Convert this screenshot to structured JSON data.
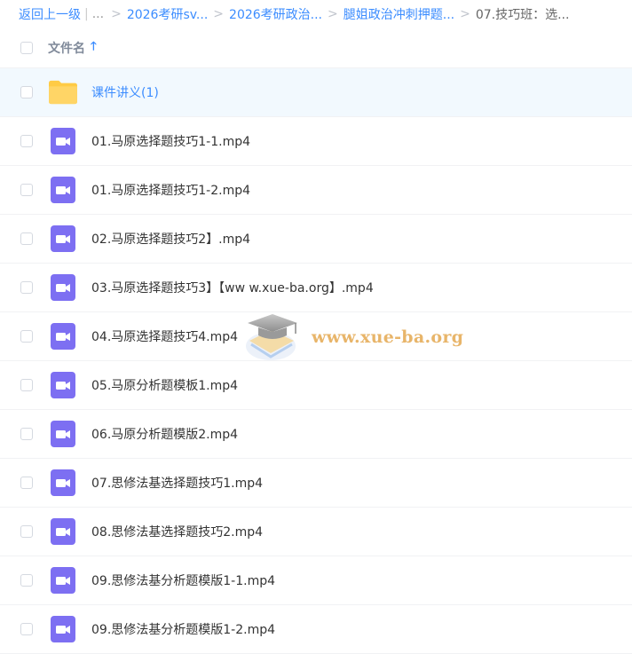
{
  "breadcrumb": {
    "back": "返回上一级",
    "dots": "...",
    "items": [
      "2026考研sv...",
      "2026考研政治...",
      "腿姐政治冲刺押题..."
    ],
    "current": "07.技巧班：选..."
  },
  "header": {
    "name_col": "文件名",
    "sort_icon": "arrow-up-icon"
  },
  "rows": [
    {
      "name": "课件讲义(1)",
      "type": "folder"
    },
    {
      "name": "01.马原选择题技巧1-1.mp4",
      "type": "video"
    },
    {
      "name": "01.马原选择题技巧1-2.mp4",
      "type": "video"
    },
    {
      "name": "02.马原选择题技巧2】.mp4",
      "type": "video"
    },
    {
      "name": "03.马原选择题技巧3】【ww w.xue-ba.org】.mp4",
      "type": "video"
    },
    {
      "name": "04.马原选择题技巧4.mp4",
      "type": "video"
    },
    {
      "name": "05.马原分析题模板1.mp4",
      "type": "video"
    },
    {
      "name": "06.马原分析题模版2.mp4",
      "type": "video"
    },
    {
      "name": "07.思修法基选择题技巧1.mp4",
      "type": "video"
    },
    {
      "name": "08.思修法基选择题技巧2.mp4",
      "type": "video"
    },
    {
      "name": "09.思修法基分析题模版1-1.mp4",
      "type": "video"
    },
    {
      "name": "09.思修法基分析题模版1-2.mp4",
      "type": "video"
    }
  ],
  "watermark": {
    "text": "www.xue-ba.org"
  },
  "colors": {
    "accent": "#3b8cff",
    "folder": "#ffcb45",
    "video": "#7d6ff2",
    "selected_row": "#f2f9fe"
  }
}
